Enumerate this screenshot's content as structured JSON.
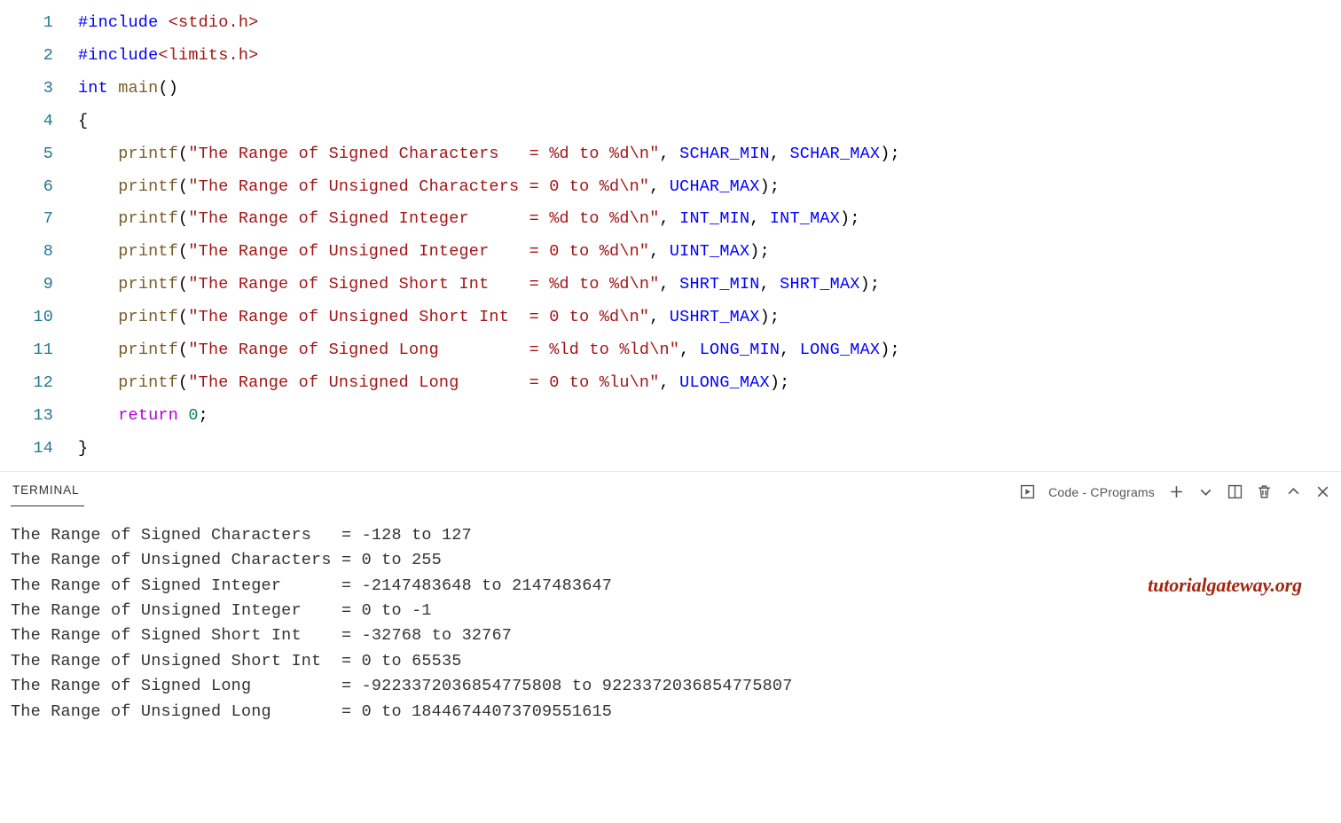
{
  "editor": {
    "lines": [
      {
        "num": "1",
        "segments": [
          {
            "cls": "kw-pp",
            "text": "#include "
          },
          {
            "cls": "include",
            "text": "<stdio.h>"
          }
        ]
      },
      {
        "num": "2",
        "segments": [
          {
            "cls": "kw-pp",
            "text": "#include"
          },
          {
            "cls": "include",
            "text": "<limits.h>"
          }
        ]
      },
      {
        "num": "3",
        "segments": [
          {
            "cls": "kw-type",
            "text": "int"
          },
          {
            "cls": "plain",
            "text": " "
          },
          {
            "cls": "func",
            "text": "main"
          },
          {
            "cls": "plain",
            "text": "()"
          }
        ]
      },
      {
        "num": "4",
        "segments": [
          {
            "cls": "brace",
            "text": "{"
          }
        ]
      },
      {
        "num": "5",
        "segments": [
          {
            "cls": "plain",
            "text": "    "
          },
          {
            "cls": "func",
            "text": "printf"
          },
          {
            "cls": "plain",
            "text": "("
          },
          {
            "cls": "string",
            "text": "\"The Range of Signed Characters   = %d to %d\\n\""
          },
          {
            "cls": "plain",
            "text": ", "
          },
          {
            "cls": "const",
            "text": "SCHAR_MIN"
          },
          {
            "cls": "plain",
            "text": ", "
          },
          {
            "cls": "const",
            "text": "SCHAR_MAX"
          },
          {
            "cls": "plain",
            "text": ")"
          },
          {
            "cls": "semi",
            "text": ";"
          }
        ]
      },
      {
        "num": "6",
        "segments": [
          {
            "cls": "plain",
            "text": "    "
          },
          {
            "cls": "func",
            "text": "printf"
          },
          {
            "cls": "plain",
            "text": "("
          },
          {
            "cls": "string",
            "text": "\"The Range of Unsigned Characters = 0 to %d\\n\""
          },
          {
            "cls": "plain",
            "text": ", "
          },
          {
            "cls": "const",
            "text": "UCHAR_MAX"
          },
          {
            "cls": "plain",
            "text": ")"
          },
          {
            "cls": "semi",
            "text": ";"
          }
        ]
      },
      {
        "num": "7",
        "segments": [
          {
            "cls": "plain",
            "text": "    "
          },
          {
            "cls": "func",
            "text": "printf"
          },
          {
            "cls": "plain",
            "text": "("
          },
          {
            "cls": "string",
            "text": "\"The Range of Signed Integer      = %d to %d\\n\""
          },
          {
            "cls": "plain",
            "text": ", "
          },
          {
            "cls": "const",
            "text": "INT_MIN"
          },
          {
            "cls": "plain",
            "text": ", "
          },
          {
            "cls": "const",
            "text": "INT_MAX"
          },
          {
            "cls": "plain",
            "text": ")"
          },
          {
            "cls": "semi",
            "text": ";"
          }
        ]
      },
      {
        "num": "8",
        "segments": [
          {
            "cls": "plain",
            "text": "    "
          },
          {
            "cls": "func",
            "text": "printf"
          },
          {
            "cls": "plain",
            "text": "("
          },
          {
            "cls": "string",
            "text": "\"The Range of Unsigned Integer    = 0 to %d\\n\""
          },
          {
            "cls": "plain",
            "text": ", "
          },
          {
            "cls": "const",
            "text": "UINT_MAX"
          },
          {
            "cls": "plain",
            "text": ")"
          },
          {
            "cls": "semi",
            "text": ";"
          }
        ]
      },
      {
        "num": "9",
        "segments": [
          {
            "cls": "plain",
            "text": "    "
          },
          {
            "cls": "func",
            "text": "printf"
          },
          {
            "cls": "plain",
            "text": "("
          },
          {
            "cls": "string",
            "text": "\"The Range of Signed Short Int    = %d to %d\\n\""
          },
          {
            "cls": "plain",
            "text": ", "
          },
          {
            "cls": "const",
            "text": "SHRT_MIN"
          },
          {
            "cls": "plain",
            "text": ", "
          },
          {
            "cls": "const",
            "text": "SHRT_MAX"
          },
          {
            "cls": "plain",
            "text": ")"
          },
          {
            "cls": "semi",
            "text": ";"
          }
        ]
      },
      {
        "num": "10",
        "segments": [
          {
            "cls": "plain",
            "text": "    "
          },
          {
            "cls": "func",
            "text": "printf"
          },
          {
            "cls": "plain",
            "text": "("
          },
          {
            "cls": "string",
            "text": "\"The Range of Unsigned Short Int  = 0 to %d\\n\""
          },
          {
            "cls": "plain",
            "text": ", "
          },
          {
            "cls": "const",
            "text": "USHRT_MAX"
          },
          {
            "cls": "plain",
            "text": ")"
          },
          {
            "cls": "semi",
            "text": ";"
          }
        ]
      },
      {
        "num": "11",
        "segments": [
          {
            "cls": "plain",
            "text": "    "
          },
          {
            "cls": "func",
            "text": "printf"
          },
          {
            "cls": "plain",
            "text": "("
          },
          {
            "cls": "string",
            "text": "\"The Range of Signed Long         = %ld to %ld\\n\""
          },
          {
            "cls": "plain",
            "text": ", "
          },
          {
            "cls": "const",
            "text": "LONG_MIN"
          },
          {
            "cls": "plain",
            "text": ", "
          },
          {
            "cls": "const",
            "text": "LONG_MAX"
          },
          {
            "cls": "plain",
            "text": ")"
          },
          {
            "cls": "semi",
            "text": ";"
          }
        ]
      },
      {
        "num": "12",
        "segments": [
          {
            "cls": "plain",
            "text": "    "
          },
          {
            "cls": "func",
            "text": "printf"
          },
          {
            "cls": "plain",
            "text": "("
          },
          {
            "cls": "string",
            "text": "\"The Range of Unsigned Long       = 0 to %lu\\n\""
          },
          {
            "cls": "plain",
            "text": ", "
          },
          {
            "cls": "const",
            "text": "ULONG_MAX"
          },
          {
            "cls": "plain",
            "text": ")"
          },
          {
            "cls": "semi",
            "text": ";"
          }
        ]
      },
      {
        "num": "13",
        "segments": [
          {
            "cls": "plain",
            "text": "    "
          },
          {
            "cls": "kw-ctrl",
            "text": "return"
          },
          {
            "cls": "plain",
            "text": " "
          },
          {
            "cls": "num",
            "text": "0"
          },
          {
            "cls": "semi",
            "text": ";"
          }
        ]
      },
      {
        "num": "14",
        "segments": [
          {
            "cls": "brace",
            "text": "}"
          }
        ]
      }
    ]
  },
  "panel": {
    "tab_label": "TERMINAL",
    "task_label": "Code - CPrograms"
  },
  "terminal": {
    "output": "The Range of Signed Characters   = -128 to 127\nThe Range of Unsigned Characters = 0 to 255\nThe Range of Signed Integer      = -2147483648 to 2147483647\nThe Range of Unsigned Integer    = 0 to -1\nThe Range of Signed Short Int    = -32768 to 32767\nThe Range of Unsigned Short Int  = 0 to 65535\nThe Range of Signed Long         = -9223372036854775808 to 9223372036854775807\nThe Range of Unsigned Long       = 0 to 18446744073709551615"
  },
  "watermark": "tutorialgateway.org"
}
